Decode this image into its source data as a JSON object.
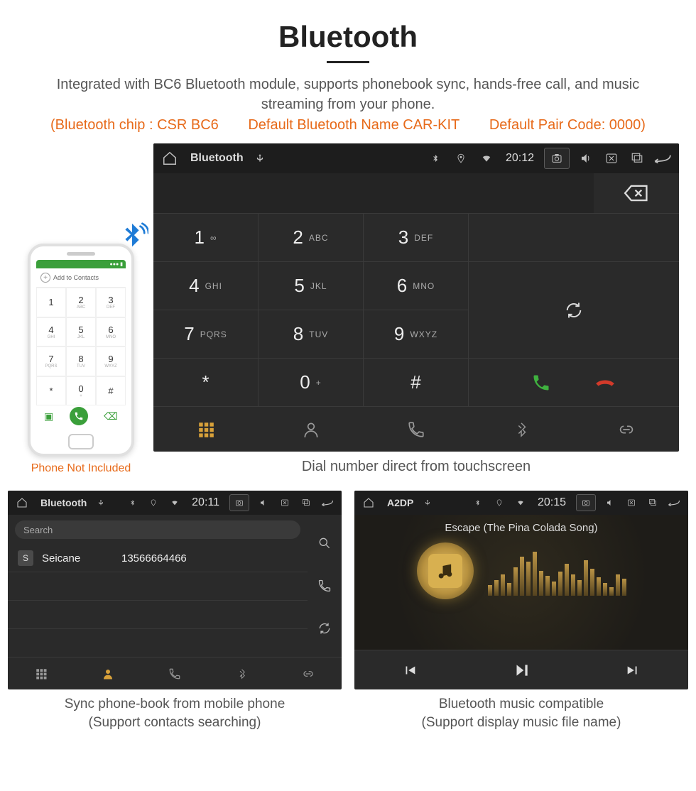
{
  "hero": {
    "title": "Bluetooth",
    "desc": "Integrated with BC6 Bluetooth module, supports phonebook sync, hands-free call, and music streaming from your phone.",
    "spec_chip": "(Bluetooth chip : CSR BC6",
    "spec_name": "Default Bluetooth Name CAR-KIT",
    "spec_code": "Default Pair Code: 0000)"
  },
  "phone": {
    "add_label": "Add to Contacts",
    "caption": "Phone Not Included",
    "keys": [
      {
        "n": "1",
        "l": ""
      },
      {
        "n": "2",
        "l": "ABC"
      },
      {
        "n": "3",
        "l": "DEF"
      },
      {
        "n": "4",
        "l": "GHI"
      },
      {
        "n": "5",
        "l": "JKL"
      },
      {
        "n": "6",
        "l": "MNO"
      },
      {
        "n": "7",
        "l": "PQRS"
      },
      {
        "n": "8",
        "l": "TUV"
      },
      {
        "n": "9",
        "l": "WXYZ"
      },
      {
        "n": "*",
        "l": ""
      },
      {
        "n": "0",
        "l": "+"
      },
      {
        "n": "#",
        "l": ""
      }
    ]
  },
  "dialer": {
    "status": {
      "title": "Bluetooth",
      "time": "20:12"
    },
    "keys": [
      {
        "n": "1",
        "l": "∞"
      },
      {
        "n": "2",
        "l": "ABC"
      },
      {
        "n": "3",
        "l": "DEF"
      },
      {
        "n": "4",
        "l": "GHI"
      },
      {
        "n": "5",
        "l": "JKL"
      },
      {
        "n": "6",
        "l": "MNO"
      },
      {
        "n": "7",
        "l": "PQRS"
      },
      {
        "n": "8",
        "l": "TUV"
      },
      {
        "n": "9",
        "l": "WXYZ"
      },
      {
        "n": "*",
        "l": ""
      },
      {
        "n": "0",
        "l": "+"
      },
      {
        "n": "#",
        "l": ""
      }
    ],
    "caption": "Dial number direct from touchscreen"
  },
  "contacts": {
    "status": {
      "title": "Bluetooth",
      "time": "20:11"
    },
    "search_placeholder": "Search",
    "row": {
      "initial": "S",
      "name": "Seicane",
      "number": "13566664466"
    },
    "caption_l1": "Sync phone-book from mobile phone",
    "caption_l2": "(Support contacts searching)"
  },
  "music": {
    "status": {
      "title": "A2DP",
      "time": "20:15"
    },
    "track": "Escape (The Pina Colada Song)",
    "caption_l1": "Bluetooth music compatible",
    "caption_l2": "(Support display music file name)"
  }
}
